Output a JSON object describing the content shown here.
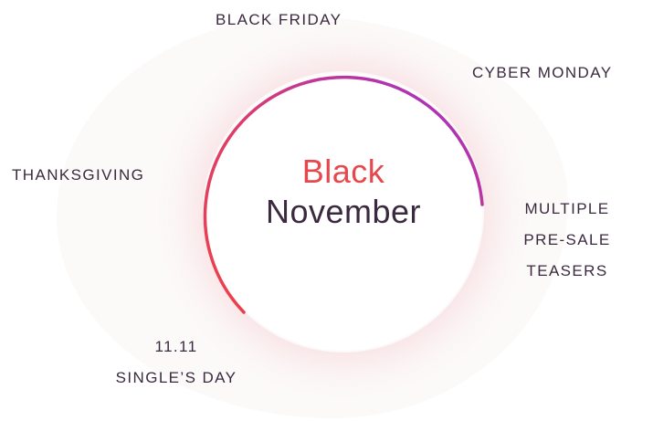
{
  "center": {
    "line1": "Black",
    "line2": "November"
  },
  "events": {
    "black_friday": "BLACK FRIDAY",
    "cyber_monday": "CYBER MONDAY",
    "thanksgiving": "THANKSGIVING",
    "pre_sale": [
      "MULTIPLE",
      "PRE-SALE",
      "TEASERS"
    ],
    "singles_day": [
      "11.11",
      "SINGLE’S DAY"
    ]
  },
  "colors": {
    "text": "#3b2a3f",
    "accent_red": "#e8474c",
    "accent_purple": "#9b33c8",
    "background_blob": "#fcf9f9"
  }
}
